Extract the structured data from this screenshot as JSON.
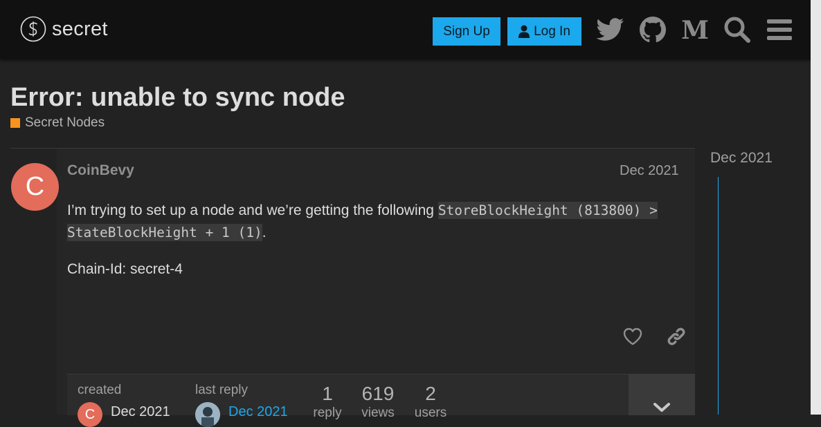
{
  "header": {
    "logo_text": "secret",
    "signup_label": "Sign Up",
    "login_label": "Log In",
    "icons": [
      "twitter-icon",
      "github-icon",
      "medium-icon",
      "search-icon",
      "hamburger-menu-icon"
    ]
  },
  "topic": {
    "title": "Error: unable to sync node",
    "category": "Secret Nodes",
    "category_color": "#f7941d"
  },
  "post": {
    "avatar_letter": "C",
    "avatar_color": "#e36c5a",
    "username": "CoinBevy",
    "date": "Dec 2021",
    "text_intro": "I’m trying to set up a node and we’re getting the following",
    "code": "StoreBlockHeight (813800) > StateBlockHeight + 1 (1)",
    "text_period": ".",
    "chain_id": "Chain-Id: secret-4"
  },
  "topic_map": {
    "created_label": "created",
    "created_avatar_letter": "C",
    "created_date": "Dec 2021",
    "last_reply_label": "last reply",
    "last_reply_date": "Dec 2021",
    "replies_count": "1",
    "replies_label": "reply",
    "views_count": "619",
    "views_label": "views",
    "users_count": "2",
    "users_label": "users"
  },
  "timeline": {
    "date": "Dec 2021"
  },
  "colors": {
    "accent": "#1ca8ec",
    "header_bg": "#111111",
    "page_bg": "#222222"
  }
}
